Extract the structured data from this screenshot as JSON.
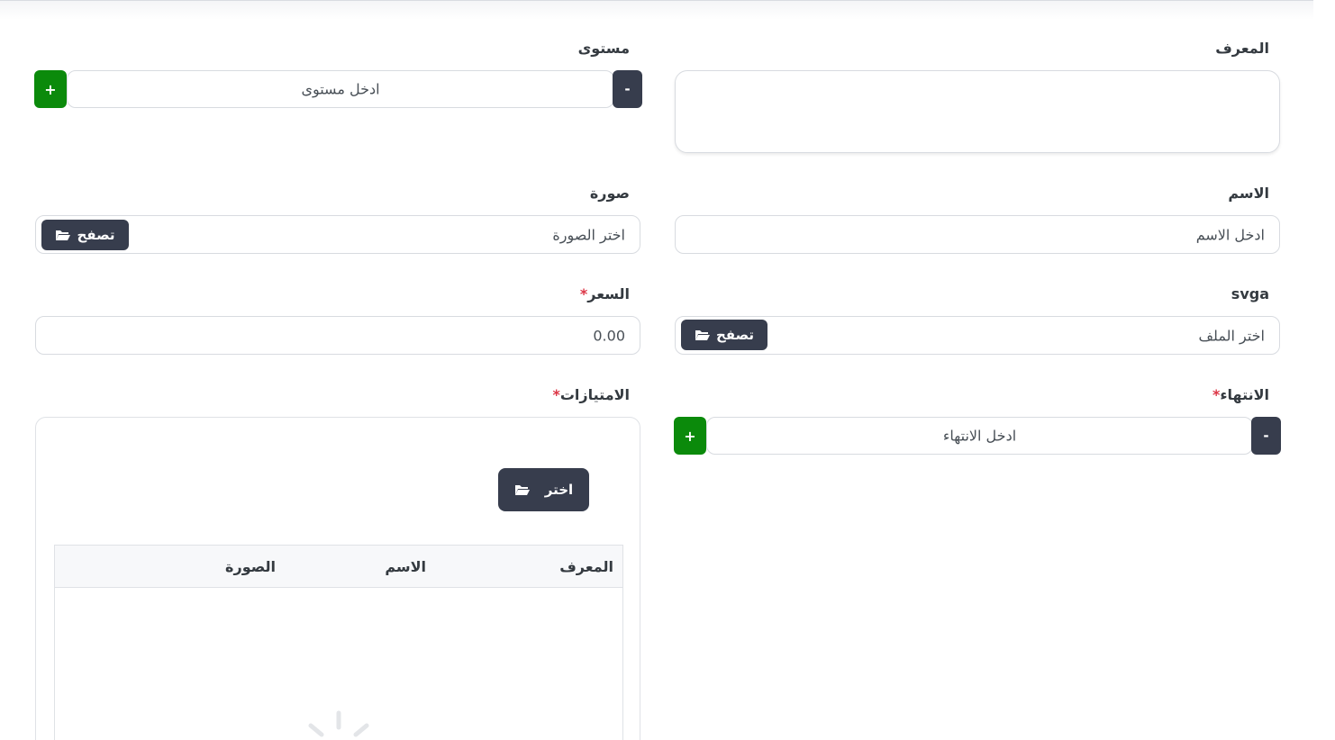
{
  "form": {
    "id": {
      "label": "المعرف",
      "value": ""
    },
    "level": {
      "label": "مستوى",
      "placeholder": "ادخل مستوى",
      "minus": "-",
      "plus": "+"
    },
    "name": {
      "label": "الاسم",
      "placeholder": "ادخل الاسم"
    },
    "image": {
      "label": "صورة",
      "placeholder": "اختر الصورة",
      "browse": "تصفح"
    },
    "svga": {
      "label": "svga",
      "placeholder": "اختر الملف",
      "browse": "تصفح"
    },
    "price": {
      "label": "السعر",
      "required_mark": "*",
      "value": "0.00"
    },
    "expiry": {
      "label": "الانتهاء",
      "required_mark": "*",
      "placeholder": "ادخل الانتهاء",
      "minus": "-",
      "plus": "+"
    },
    "privileges": {
      "label": "الامتيازات",
      "required_mark": "*",
      "choose": "اختر",
      "columns": [
        "المعرف",
        "الاسم",
        "الصورة"
      ]
    }
  },
  "icons": {
    "folder": "folder-open-icon",
    "loading": "loading-spinner-icon"
  },
  "colors": {
    "dark_button": "#373d4d",
    "green_button": "#0b8a0b",
    "required": "#dc3545"
  }
}
